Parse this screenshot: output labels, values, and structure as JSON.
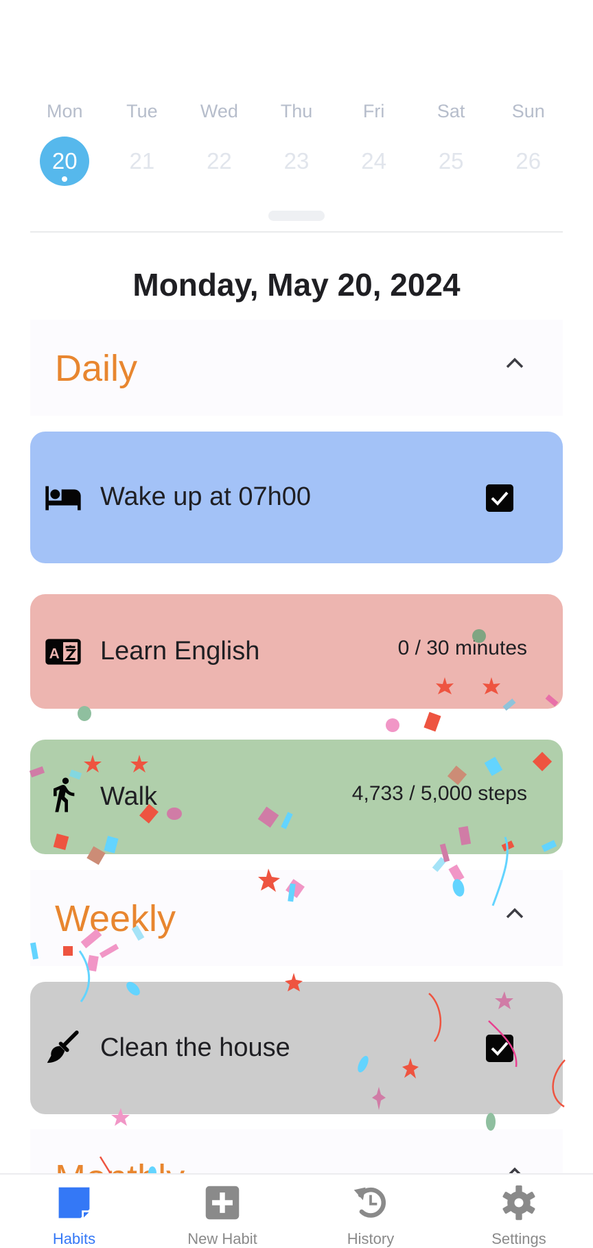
{
  "week": {
    "days": [
      {
        "name": "Mon",
        "date": "20",
        "selected": true
      },
      {
        "name": "Tue",
        "date": "21",
        "selected": false
      },
      {
        "name": "Wed",
        "date": "22",
        "selected": false
      },
      {
        "name": "Thu",
        "date": "23",
        "selected": false
      },
      {
        "name": "Fri",
        "date": "24",
        "selected": false
      },
      {
        "name": "Sat",
        "date": "25",
        "selected": false
      },
      {
        "name": "Sun",
        "date": "26",
        "selected": false
      }
    ]
  },
  "date_title": "Monday, May 20, 2024",
  "sections": [
    {
      "title": "Daily",
      "expanded": true
    },
    {
      "title": "Weekly",
      "expanded": true
    },
    {
      "title": "Monthly",
      "expanded": true
    }
  ],
  "habits": [
    {
      "label": "Wake up at 07h00",
      "icon": "bed-icon",
      "completed": true,
      "color": "#a3c2f7"
    },
    {
      "label": "Learn English",
      "icon": "translate-icon",
      "progress": "0 / 30 minutes",
      "color": "#edb5b0"
    },
    {
      "label": "Walk",
      "icon": "walking-icon",
      "progress": "4,733 / 5,000 steps",
      "color": "#b0cfab"
    },
    {
      "label": "Clean the house",
      "icon": "broom-icon",
      "completed": true,
      "color": "#cccccc"
    }
  ],
  "nav": {
    "items": [
      {
        "label": "Habits",
        "icon": "habits-icon",
        "active": true
      },
      {
        "label": "New Habit",
        "icon": "add-box-icon",
        "active": false
      },
      {
        "label": "History",
        "icon": "history-icon",
        "active": false
      },
      {
        "label": "Settings",
        "icon": "gear-icon",
        "active": false
      }
    ]
  },
  "colors": {
    "accent": "#56b8ec",
    "section_title": "#e8862f",
    "nav_active": "#3478f6",
    "nav_inactive": "#8a8a8a"
  }
}
